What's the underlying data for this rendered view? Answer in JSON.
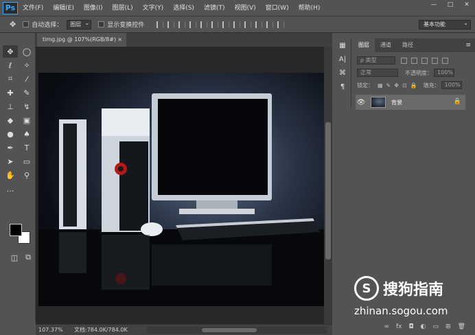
{
  "app": {
    "logo": "Ps"
  },
  "menu": [
    "文件(F)",
    "编辑(E)",
    "图像(I)",
    "图层(L)",
    "文字(Y)",
    "选择(S)",
    "滤镜(T)",
    "视图(V)",
    "窗口(W)",
    "帮助(H)"
  ],
  "window_controls": [
    "—",
    "□",
    "✕"
  ],
  "options": {
    "auto_select_label": "自动选择：",
    "auto_select_value": "图层",
    "show_transform_label": "显示变换控件",
    "workspace": "基本功能"
  },
  "document": {
    "tab_title": "timg.jpg @ 107%(RGB/8#)",
    "close": "×"
  },
  "status": {
    "zoom": "107.37%",
    "docsize": "文档:784.0K/784.0K"
  },
  "layers_panel": {
    "tabs": [
      "图层",
      "通道",
      "路径"
    ],
    "filter_placeholder": "ρ 类型",
    "blend_mode": "正常",
    "opacity_label": "不透明度：",
    "opacity_value": "100%",
    "lock_label": "锁定：",
    "fill_label": "填充：",
    "fill_value": "100%",
    "layer_name": "背景",
    "bottom_icons": [
      "∞",
      "fx",
      "◘",
      "◐",
      "▭",
      "⊞",
      "🗑"
    ]
  },
  "watermark": {
    "logo_letter": "S",
    "brand": "搜狗指南",
    "url": "zhinan.sogou.com"
  },
  "colors": {
    "panel": "#535353",
    "dark": "#282828",
    "accent": "#31a8ff"
  }
}
